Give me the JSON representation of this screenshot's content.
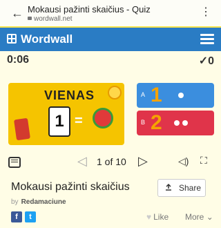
{
  "browser": {
    "title": "Mokausi pažinti skaičius - Quiz",
    "url": "wordwall.net"
  },
  "header": {
    "logo_text": "Wordwall",
    "brand_color": "#2a7cc4"
  },
  "game": {
    "timer": "0:06",
    "score": "0",
    "question_image": {
      "word": "VIENAS",
      "digit": "1"
    },
    "answers": [
      {
        "letter": "A",
        "digit": "1",
        "color": "#3b8ede"
      },
      {
        "letter": "B",
        "digit": "2",
        "color": "#e0344a"
      }
    ]
  },
  "controls": {
    "page_info": "1 of 10"
  },
  "activity": {
    "title": "Mokausi pažinti skaičius",
    "by_label": "by",
    "author": "Redamaciune",
    "share_label": "Share",
    "like_label": "Like",
    "more_label": "More"
  }
}
